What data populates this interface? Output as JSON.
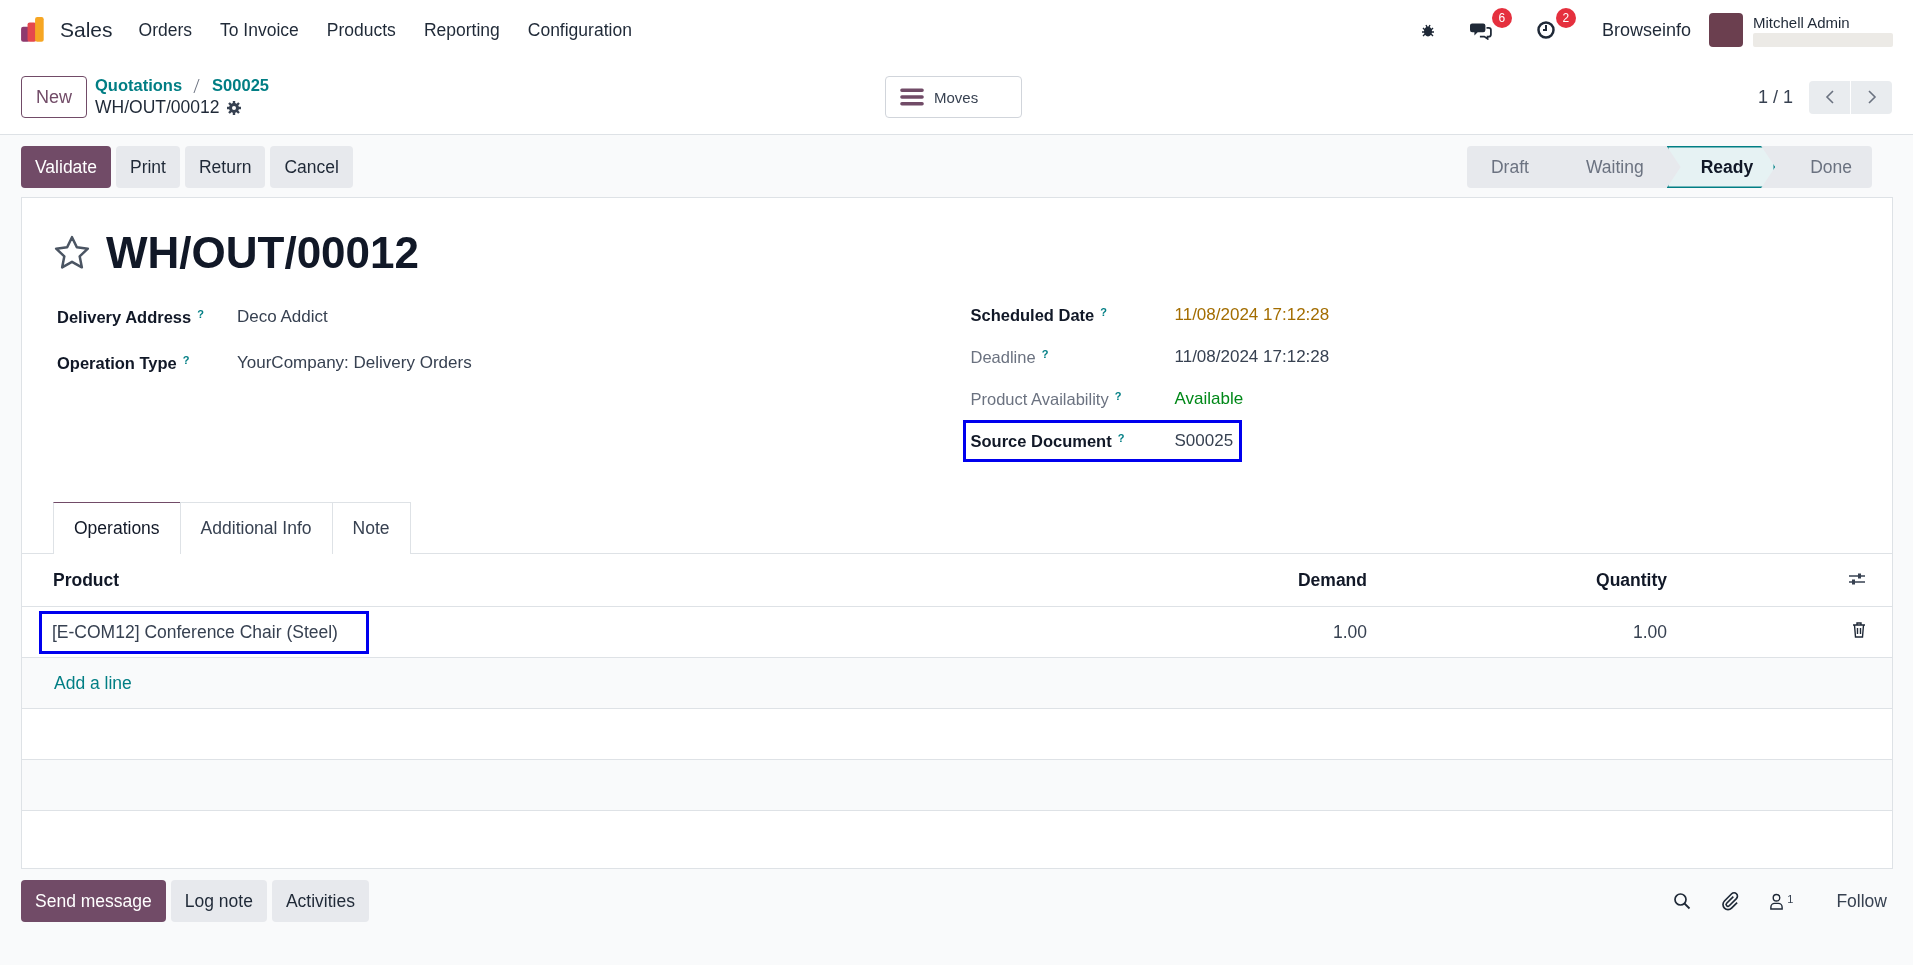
{
  "navbar": {
    "app_name": "Sales",
    "menu": [
      "Orders",
      "To Invoice",
      "Products",
      "Reporting",
      "Configuration"
    ],
    "messages_count": "6",
    "activities_count": "2",
    "company": "Browseinfo",
    "user": "Mitchell Admin"
  },
  "control_panel": {
    "new_button": "New",
    "breadcrumbs": [
      "Quotations",
      "S00025"
    ],
    "record": "WH/OUT/00012",
    "moves_button": "Moves",
    "pager": "1 / 1"
  },
  "actions": [
    {
      "label": "Validate",
      "kind": "primary"
    },
    {
      "label": "Print",
      "kind": "secondary"
    },
    {
      "label": "Return",
      "kind": "secondary"
    },
    {
      "label": "Cancel",
      "kind": "secondary"
    }
  ],
  "stages": [
    {
      "label": "Draft",
      "selected": false
    },
    {
      "label": "Waiting",
      "selected": false
    },
    {
      "label": "Ready",
      "selected": true
    },
    {
      "label": "Done",
      "selected": false
    }
  ],
  "form": {
    "title": "WH/OUT/00012",
    "starred": false,
    "left_fields": [
      {
        "label": "Delivery Address",
        "help": "?",
        "value": "Deco Addict",
        "muted": false,
        "color": "#374151",
        "highlighted": false
      },
      {
        "label": "Operation Type",
        "help": "?",
        "value": "YourCompany: Delivery Orders",
        "muted": false,
        "color": "#374151",
        "highlighted": false
      }
    ],
    "right_fields": [
      {
        "label": "Scheduled Date",
        "help": "?",
        "value": "11/08/2024 17:12:28",
        "muted": false,
        "color": "#a36d00",
        "highlighted": false
      },
      {
        "label": "Deadline",
        "help": "?",
        "value": "11/08/2024 17:12:28",
        "muted": true,
        "color": "#374151",
        "highlighted": false
      },
      {
        "label": "Product Availability",
        "help": "?",
        "value": "Available",
        "muted": true,
        "color": "#008818",
        "highlighted": false
      },
      {
        "label": "Source Document",
        "help": "?",
        "value": "S00025",
        "muted": false,
        "color": "#374151",
        "highlighted": true
      }
    ]
  },
  "tabs": [
    {
      "label": "Operations",
      "selected": true
    },
    {
      "label": "Additional Info",
      "selected": false
    },
    {
      "label": "Note",
      "selected": false
    }
  ],
  "table": {
    "columns": [
      "Product",
      "Demand",
      "Quantity"
    ],
    "rows": [
      {
        "product": "[E-COM12] Conference Chair (Steel)",
        "demand": "1.00",
        "quantity": "1.00",
        "highlighted": true
      }
    ],
    "add_line": "Add a line"
  },
  "chatter": {
    "buttons": [
      {
        "label": "Send message",
        "kind": "primary"
      },
      {
        "label": "Log note",
        "kind": "secondary"
      },
      {
        "label": "Activities",
        "kind": "secondary"
      }
    ],
    "followers_count": "1",
    "follow": "Follow"
  }
}
